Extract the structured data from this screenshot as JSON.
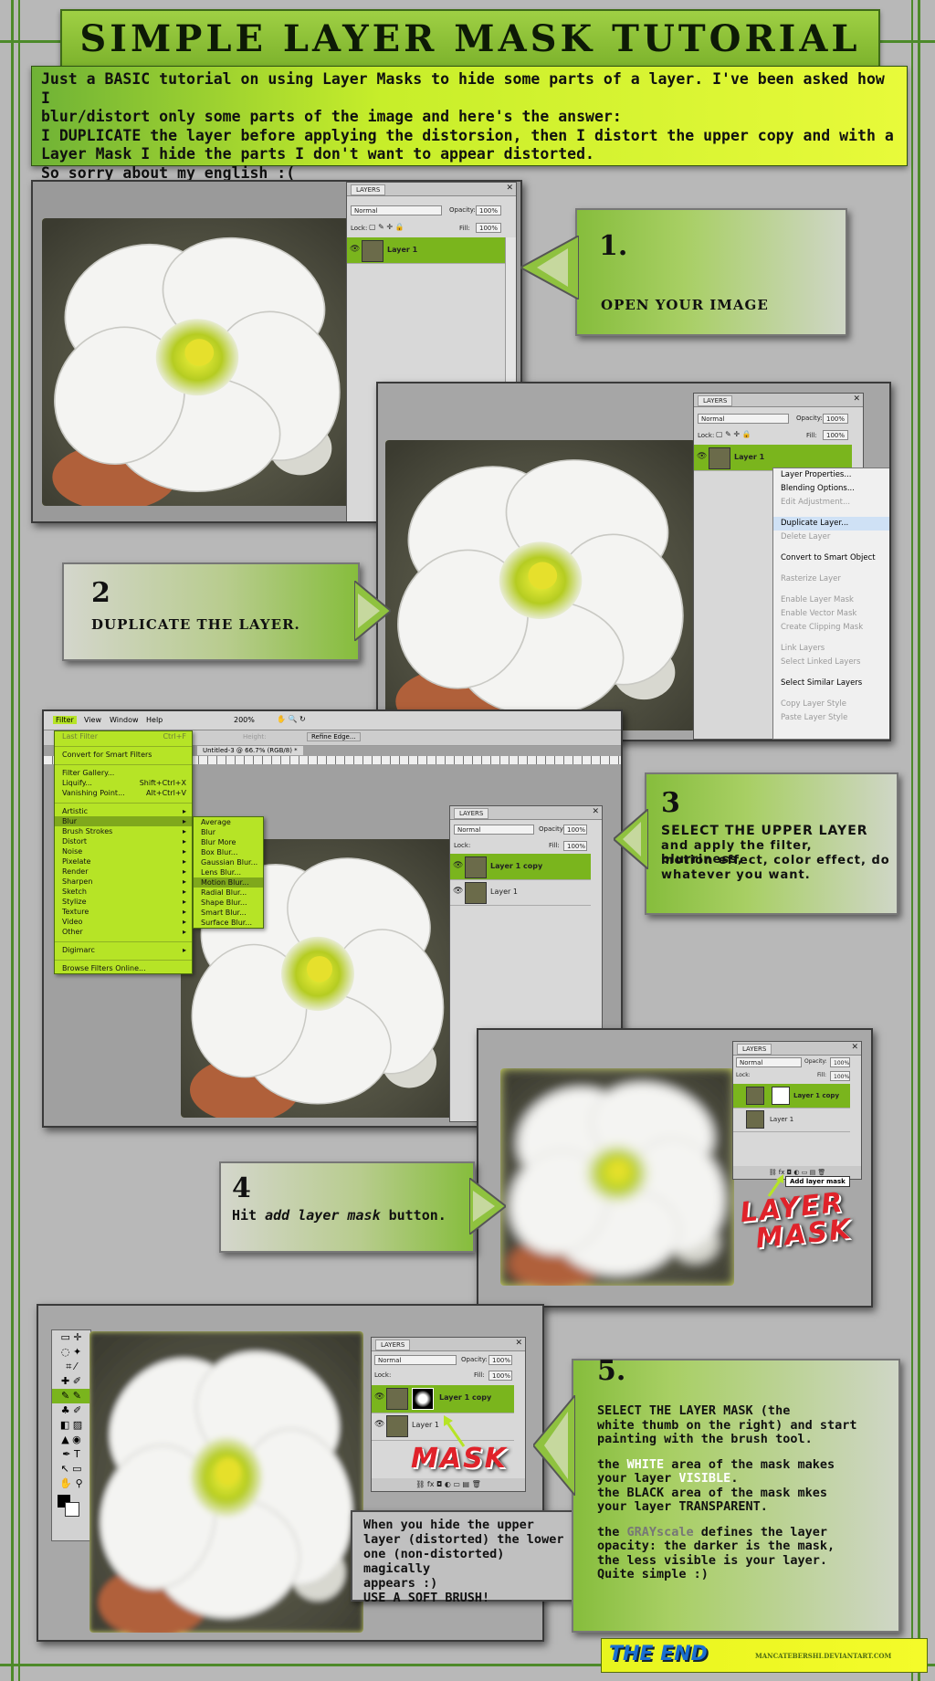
{
  "title": "SIMPLE LAYER MASK TUTORIAL",
  "intro": [
    "Just a BASIC tutorial on using Layer Masks to hide some parts of a layer.  I've been asked how I",
    "blur/distort only some parts of the image and here's the answer:",
    "I DUPLICATE the layer before applying the distorsion, then I distort the upper copy and with a",
    "Layer Mask  I hide the parts I don't want to appear distorted.",
    "So sorry about my english :("
  ],
  "layers_panel": {
    "tab": "LAYERS",
    "blend_mode": "Normal",
    "opacity_label": "Opacity:",
    "opacity_value": "100%",
    "lock_label": "Lock:",
    "fill_label": "Fill:",
    "fill_value": "100%",
    "layer1": "Layer 1",
    "layer1_copy": "Layer 1 copy"
  },
  "step1": {
    "num": "1.",
    "text": "OPEN YOUR IMAGE"
  },
  "step2": {
    "num": "2",
    "text": "DUPLICATE THE LAYER."
  },
  "context_menu": [
    {
      "label": "Layer Properties...",
      "state": "normal"
    },
    {
      "label": "Blending Options...",
      "state": "normal"
    },
    {
      "label": "Edit Adjustment...",
      "state": "disabled"
    },
    {
      "label": "",
      "state": "sep"
    },
    {
      "label": "Duplicate Layer...",
      "state": "highlight"
    },
    {
      "label": "Delete Layer",
      "state": "disabled"
    },
    {
      "label": "",
      "state": "sep"
    },
    {
      "label": "Convert to Smart Object",
      "state": "normal"
    },
    {
      "label": "",
      "state": "sep"
    },
    {
      "label": "Rasterize Layer",
      "state": "disabled"
    },
    {
      "label": "",
      "state": "sep"
    },
    {
      "label": "Enable Layer Mask",
      "state": "disabled"
    },
    {
      "label": "Enable Vector Mask",
      "state": "disabled"
    },
    {
      "label": "Create Clipping Mask",
      "state": "disabled"
    },
    {
      "label": "",
      "state": "sep"
    },
    {
      "label": "Link Layers",
      "state": "disabled"
    },
    {
      "label": "Select Linked Layers",
      "state": "disabled"
    },
    {
      "label": "",
      "state": "sep"
    },
    {
      "label": "Select Similar Layers",
      "state": "normal"
    },
    {
      "label": "",
      "state": "sep"
    },
    {
      "label": "Copy Layer Style",
      "state": "disabled"
    },
    {
      "label": "Paste Layer Style",
      "state": "disabled"
    }
  ],
  "ps_menubar": {
    "filter": "Filter",
    "view": "View",
    "window": "Window",
    "help": "Help",
    "zoom": "200%",
    "height_label": "Height:",
    "refine": "Refine Edge...",
    "doc_tab": "Untitled-3 @ 66.7% (RGB/8) *"
  },
  "filter_menu": [
    {
      "label": "Last Filter",
      "acc": "Ctrl+F",
      "state": "dim"
    },
    {
      "label": "",
      "state": "sep"
    },
    {
      "label": "Convert for Smart Filters",
      "acc": "",
      "state": "normal"
    },
    {
      "label": "",
      "state": "sep"
    },
    {
      "label": "Filter Gallery...",
      "acc": "",
      "state": "normal"
    },
    {
      "label": "Liquify...",
      "acc": "Shift+Ctrl+X",
      "state": "normal"
    },
    {
      "label": "Vanishing Point...",
      "acc": "Alt+Ctrl+V",
      "state": "normal"
    },
    {
      "label": "",
      "state": "sep"
    },
    {
      "label": "Artistic",
      "acc": "▸",
      "state": "normal"
    },
    {
      "label": "Blur",
      "acc": "▸",
      "state": "hl"
    },
    {
      "label": "Brush Strokes",
      "acc": "▸",
      "state": "normal"
    },
    {
      "label": "Distort",
      "acc": "▸",
      "state": "normal"
    },
    {
      "label": "Noise",
      "acc": "▸",
      "state": "normal"
    },
    {
      "label": "Pixelate",
      "acc": "▸",
      "state": "normal"
    },
    {
      "label": "Render",
      "acc": "▸",
      "state": "normal"
    },
    {
      "label": "Sharpen",
      "acc": "▸",
      "state": "normal"
    },
    {
      "label": "Sketch",
      "acc": "▸",
      "state": "normal"
    },
    {
      "label": "Stylize",
      "acc": "▸",
      "state": "normal"
    },
    {
      "label": "Texture",
      "acc": "▸",
      "state": "normal"
    },
    {
      "label": "Video",
      "acc": "▸",
      "state": "normal"
    },
    {
      "label": "Other",
      "acc": "▸",
      "state": "normal"
    },
    {
      "label": "",
      "state": "sep"
    },
    {
      "label": "Digimarc",
      "acc": "▸",
      "state": "normal"
    },
    {
      "label": "",
      "state": "sep"
    },
    {
      "label": "Browse Filters Online...",
      "acc": "",
      "state": "normal"
    }
  ],
  "blur_menu": [
    {
      "label": "Average",
      "state": "normal"
    },
    {
      "label": "Blur",
      "state": "normal"
    },
    {
      "label": "Blur More",
      "state": "normal"
    },
    {
      "label": "Box Blur...",
      "state": "normal"
    },
    {
      "label": "Gaussian Blur...",
      "state": "normal"
    },
    {
      "label": "Lens Blur...",
      "state": "normal"
    },
    {
      "label": "Motion Blur...",
      "state": "hl"
    },
    {
      "label": "Radial Blur...",
      "state": "normal"
    },
    {
      "label": "Shape Blur...",
      "state": "normal"
    },
    {
      "label": "Smart Blur...",
      "state": "normal"
    },
    {
      "label": "Surface Blur...",
      "state": "normal"
    }
  ],
  "step3": {
    "num": "3",
    "title": "SELECT THE UPPER LAYER",
    "body": [
      "and apply the filter, blurriness,",
      "motion effect, color effect, do",
      "whatever you want."
    ]
  },
  "step4": {
    "num": "4",
    "pre": "Hit ",
    "em": "add layer mask",
    "post": " button.",
    "tooltip": "Add layer mask",
    "callout": [
      "LAYER",
      "MASK"
    ]
  },
  "step5": {
    "num": "5.",
    "p1": [
      "SELECT THE LAYER MASK (the",
      "white thumb on the right) and start",
      "painting with the brush tool."
    ],
    "p2a": "the ",
    "p2w": "WHITE",
    "p2b": " area of the mask makes",
    "p2c": "your layer ",
    "p2v": "VISIBLE",
    "p2d": ".",
    "p3": [
      "the BLACK area of the mask mkes",
      "your layer TRANSPARENT."
    ],
    "p4a": "the ",
    "p4g": "GRAYscale",
    "p4b": " defines the layer",
    "p4": [
      "opacity: the darker is the mask,",
      "the less visible is your layer.",
      "Quite simple :)"
    ],
    "callout": "MASK"
  },
  "note": [
    "When you hide the upper",
    "layer (distorted) the lower",
    "one (non-distorted) magically",
    "appears :)",
    "USE A SOFT BRUSH!"
  ],
  "footer": {
    "the_end": "THE END",
    "credit": "MANCATEBERSHI.DEVIANTART.COM"
  },
  "colors": {
    "green": "#7ab51d",
    "lime": "#c7ee2a",
    "frame": "#4d8a2a",
    "red": "#e0222a"
  }
}
